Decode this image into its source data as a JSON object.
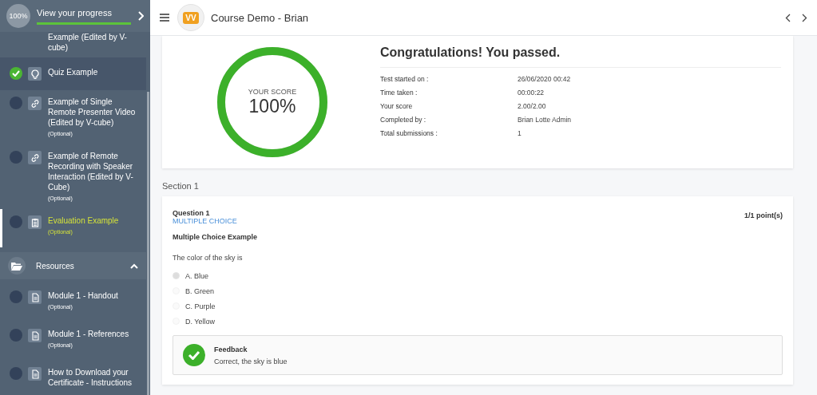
{
  "progress": {
    "percent": "100%",
    "label": "View your progress",
    "level": 1.0
  },
  "sidebar": {
    "items": [
      {
        "kind": "partial",
        "title": "Example (Edited by V-cube)",
        "highlighted": false,
        "selected": false
      },
      {
        "kind": "quiz",
        "title": "Quiz Example",
        "completed": true,
        "highlighted": true,
        "selected": false
      },
      {
        "kind": "link",
        "title": "Example of Single Remote Presenter Video (Edited by V-cube)",
        "note": "(Optional)",
        "completed": false,
        "highlighted": false,
        "selected": false
      },
      {
        "kind": "link",
        "title": "Example of Remote Recording with Speaker Interaction (Edited by V-Cube)",
        "note": "(Optional)",
        "completed": false,
        "highlighted": false,
        "selected": false
      },
      {
        "kind": "evaluation",
        "title": "Evaluation Example",
        "note": "(Optional)",
        "completed": false,
        "highlighted": false,
        "selected": true
      },
      {
        "kind": "section",
        "title": "Resources",
        "expanded": true
      },
      {
        "kind": "resource",
        "title": "Module 1 - Handout",
        "note": "(Optional)",
        "completed": false,
        "highlighted": false,
        "selected": false
      },
      {
        "kind": "resource",
        "title": "Module 1 - References",
        "note": "(Optional)",
        "completed": false,
        "highlighted": false,
        "selected": false
      },
      {
        "kind": "resource",
        "title": "How to Download your Certificate - Instructions",
        "completed": false,
        "highlighted": false,
        "selected": false
      }
    ]
  },
  "header": {
    "title": "Course Demo - Brian",
    "logo": "VV"
  },
  "result": {
    "score_label": "YOUR SCORE",
    "score": "100%",
    "level": 1.0,
    "heading": "Congratulations! You passed.",
    "details": [
      {
        "label": "Test started on :",
        "value": "26/06/2020 00:42"
      },
      {
        "label": "Time taken :",
        "value": "00:00:22"
      },
      {
        "label": "Your score",
        "value": "2.00/2.00"
      },
      {
        "label": "Completed by :",
        "value": "Brian Lotte Admin"
      },
      {
        "label": "Total submissions :",
        "value": "1"
      }
    ]
  },
  "section_title": "Section 1",
  "question": {
    "number": "Question 1",
    "type": "MULTIPLE CHOICE",
    "points": "1/1 point(s)",
    "title": "Multiple Choice Example",
    "prompt": "The color of the sky is",
    "options": [
      {
        "label": "A. Blue",
        "selected": true
      },
      {
        "label": "B. Green",
        "selected": false
      },
      {
        "label": "C. Purple",
        "selected": false
      },
      {
        "label": "D. Yellow",
        "selected": false
      }
    ],
    "feedback": {
      "title": "Feedback",
      "text": "Correct, the sky is blue",
      "correct": true
    }
  }
}
